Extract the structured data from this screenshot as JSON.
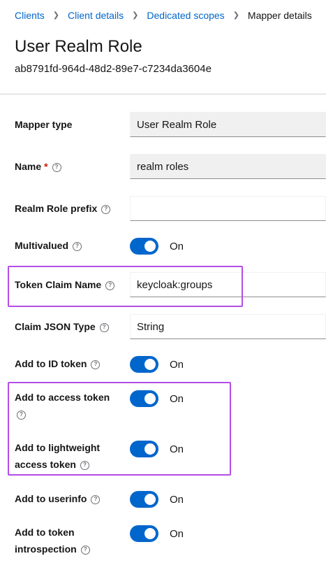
{
  "breadcrumb": {
    "items": [
      "Clients",
      "Client details",
      "Dedicated scopes"
    ],
    "current": "Mapper details",
    "separator_icon": "chevron-right-icon"
  },
  "header": {
    "title": "User Realm Role",
    "subtitle": "ab8791fd-964d-48d2-89e7-c7234da3604e"
  },
  "form": {
    "mapper_type": {
      "label": "Mapper type",
      "value": "User Realm Role"
    },
    "name": {
      "label": "Name",
      "required_mark": "*",
      "value": "realm roles"
    },
    "realm_role_prefix": {
      "label": "Realm Role prefix",
      "value": ""
    },
    "multivalued": {
      "label": "Multivalued",
      "state": "On"
    },
    "token_claim_name": {
      "label": "Token Claim Name",
      "value": "keycloak:groups"
    },
    "claim_json_type": {
      "label": "Claim JSON Type",
      "value": "String"
    },
    "add_to_id_token": {
      "label": "Add to ID token",
      "state": "On"
    },
    "add_to_access_token": {
      "label_line1": "Add to access token",
      "state": "On"
    },
    "add_to_lightweight_access_token": {
      "label_line1": "Add to lightweight",
      "label_line2": "access token",
      "state": "On"
    },
    "add_to_userinfo": {
      "label": "Add to userinfo",
      "state": "On"
    },
    "add_to_token_introspection": {
      "label_line1": "Add to token",
      "label_line2": "introspection",
      "state": "On"
    }
  },
  "help_icon_glyph": "?",
  "colors": {
    "link": "#0066cc",
    "toggle_on": "#0066cc",
    "highlight": "#b44de6",
    "required": "#c9190b",
    "readonly_bg": "#f0f0f0"
  }
}
